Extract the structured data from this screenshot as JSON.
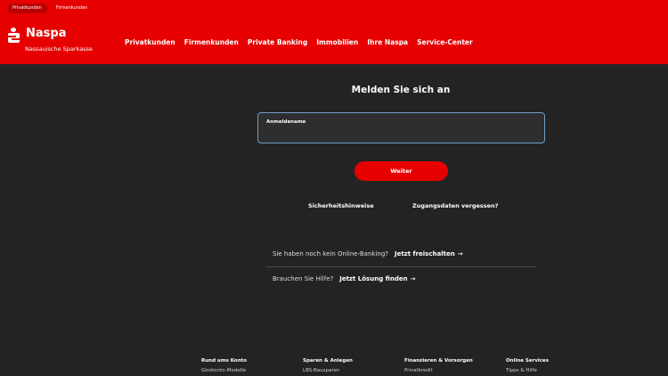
{
  "header": {
    "segments": [
      "Privatkunden",
      "Firmenkunden"
    ],
    "active_segment": "Privatkunden",
    "brand_name": "Naspa",
    "brand_subtitle": "Nassauische Sparkasse",
    "nav": [
      "Privatkunden",
      "Firmenkunden",
      "Private Banking",
      "Immobilien",
      "Ihre Naspa",
      "Service-Center"
    ]
  },
  "login": {
    "title": "Melden Sie sich an",
    "username_label": "Anmeldename",
    "username_value": "",
    "submit_label": "Weiter",
    "links": {
      "security": "Sicherheitshinweise",
      "separator": "·",
      "forgot": "Zugangsdaten vergessen?"
    },
    "register": {
      "question": "Sie haben noch kein Online-Banking?",
      "action": "Jetzt freischalten"
    },
    "help": {
      "question": "Brauchen Sie Hilfe?",
      "action": "Jetzt Lösung finden"
    },
    "arrow": "→"
  },
  "footer": {
    "columns": [
      {
        "heading": "Rund ums Konto",
        "first_item": "Girokonto-Modelle"
      },
      {
        "heading": "Sparen & Anlegen",
        "first_item": "LBS-Bausparen"
      },
      {
        "heading": "Finanzieren & Vorsorgen",
        "first_item": "Privatkredit"
      },
      {
        "heading": "Online Services",
        "first_item": "Tipps & Hilfe"
      }
    ]
  },
  "colors": {
    "brand_red": "#e60000",
    "background": "#232323",
    "field_border": "#6fa0c8"
  }
}
